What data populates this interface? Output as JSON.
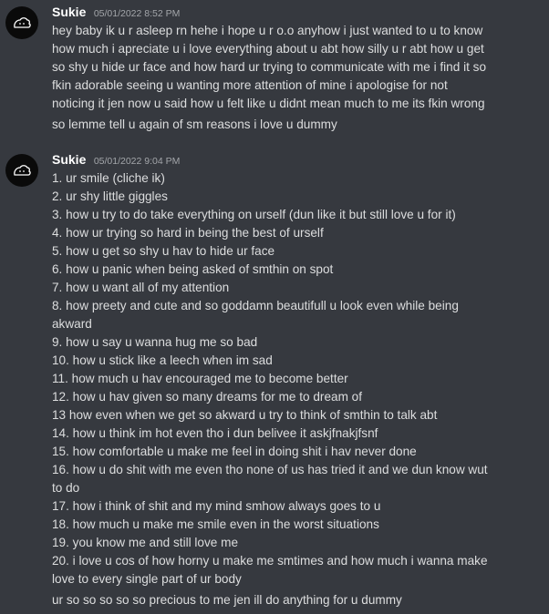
{
  "messages": [
    {
      "username": "Sukie",
      "timestamp": "05/01/2022 8:52 PM",
      "lines": [
        "hey baby ik u r asleep rn hehe i hope u r o.o anyhow i just wanted to u to know",
        "how much i apreciate u i love everything about u abt how silly u r abt how u get",
        "so shy u hide ur face and how hard ur trying to communicate with me i find it so",
        "fkin adorable seeing u wanting more attention of mine i apologise for not",
        "noticing it jen now u said how u felt like u didnt mean much to me its fkin wrong"
      ],
      "followup": "so lemme tell u again of sm reasons i love u dummy"
    },
    {
      "username": "Sukie",
      "timestamp": "05/01/2022 9:04 PM",
      "lines": [
        "1. ur smile (cliche ik)",
        "2. ur shy little giggles",
        "3. how u try to do take everything on urself (dun like it but still love u for it)",
        "4. how ur trying so hard in being the best of urself",
        "5. how u get so shy u hav to hide ur face",
        "6. how u panic when being asked of smthin on spot",
        "7. how u want all of my attention",
        "8. how preety and cute and so goddamn beautifull u look even while being",
        "akward",
        "9. how u say u wanna hug me so bad",
        "10. how u stick like a leech when im sad",
        "11. how much u hav encouraged me to become better",
        "12. how u hav given so many dreams for me to dream of",
        "13 how even when we get so akward u try to think of smthin to talk abt",
        "14. how u think im hot even tho i dun belivee it askjfnakjfsnf",
        "15. how comfortable u make me feel in doing shit i hav never done",
        "16. how u do shit with me even tho none of us has tried it and we dun know wut",
        "to do",
        "17. how i think of shit and my mind smhow always goes to u",
        "18. how much u make me smile even in the worst situations",
        "19.  you know me and still love me",
        "20. i love u cos of how horny u make me smtimes and how much i wanna make",
        "love to every single part of ur body"
      ],
      "followup": "ur so so so so so precious to me jen ill do anything for u dummy"
    }
  ]
}
